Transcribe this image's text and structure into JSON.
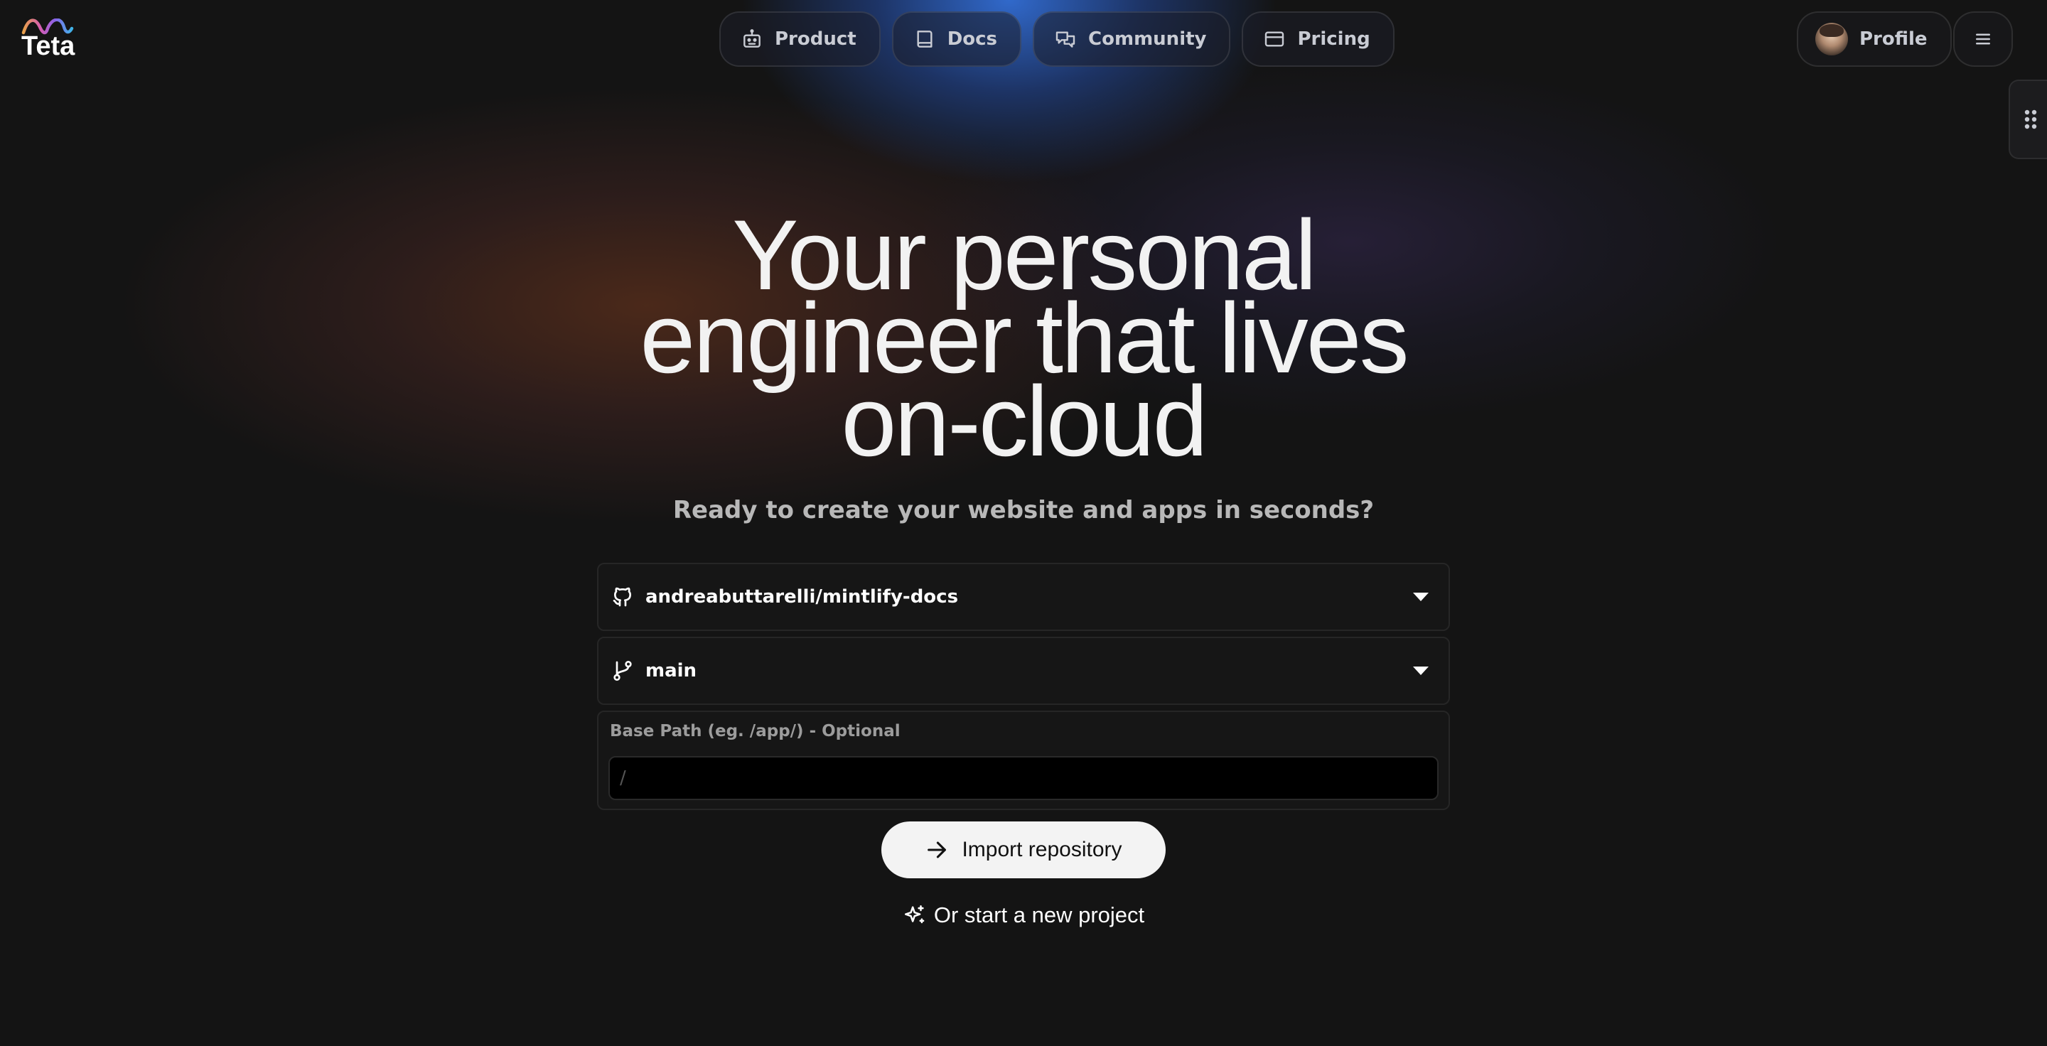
{
  "brand": {
    "name": "Teta"
  },
  "nav": {
    "items": [
      {
        "label": "Product",
        "icon": "robot-icon"
      },
      {
        "label": "Docs",
        "icon": "book-icon"
      },
      {
        "label": "Community",
        "icon": "chat-bubbles-icon"
      },
      {
        "label": "Pricing",
        "icon": "credit-card-icon"
      }
    ],
    "profile_label": "Profile"
  },
  "hero": {
    "title_lines": [
      "Your personal",
      "engineer that lives",
      "on-cloud"
    ],
    "subtitle": "Ready to create your website and apps in seconds?"
  },
  "form": {
    "repository": {
      "value": "andreabuttarelli/mintlify-docs",
      "icon": "github-icon"
    },
    "branch": {
      "value": "main",
      "icon": "git-branch-icon"
    },
    "base_path": {
      "label": "Base Path (eg. /app/) - Optional",
      "placeholder": "/"
    },
    "import_button": "Import repository",
    "new_project_link": "Or start a new project"
  },
  "colors": {
    "background": "#141414",
    "accent_glow": "#3678eb",
    "button_bg": "#f3f3f3"
  }
}
